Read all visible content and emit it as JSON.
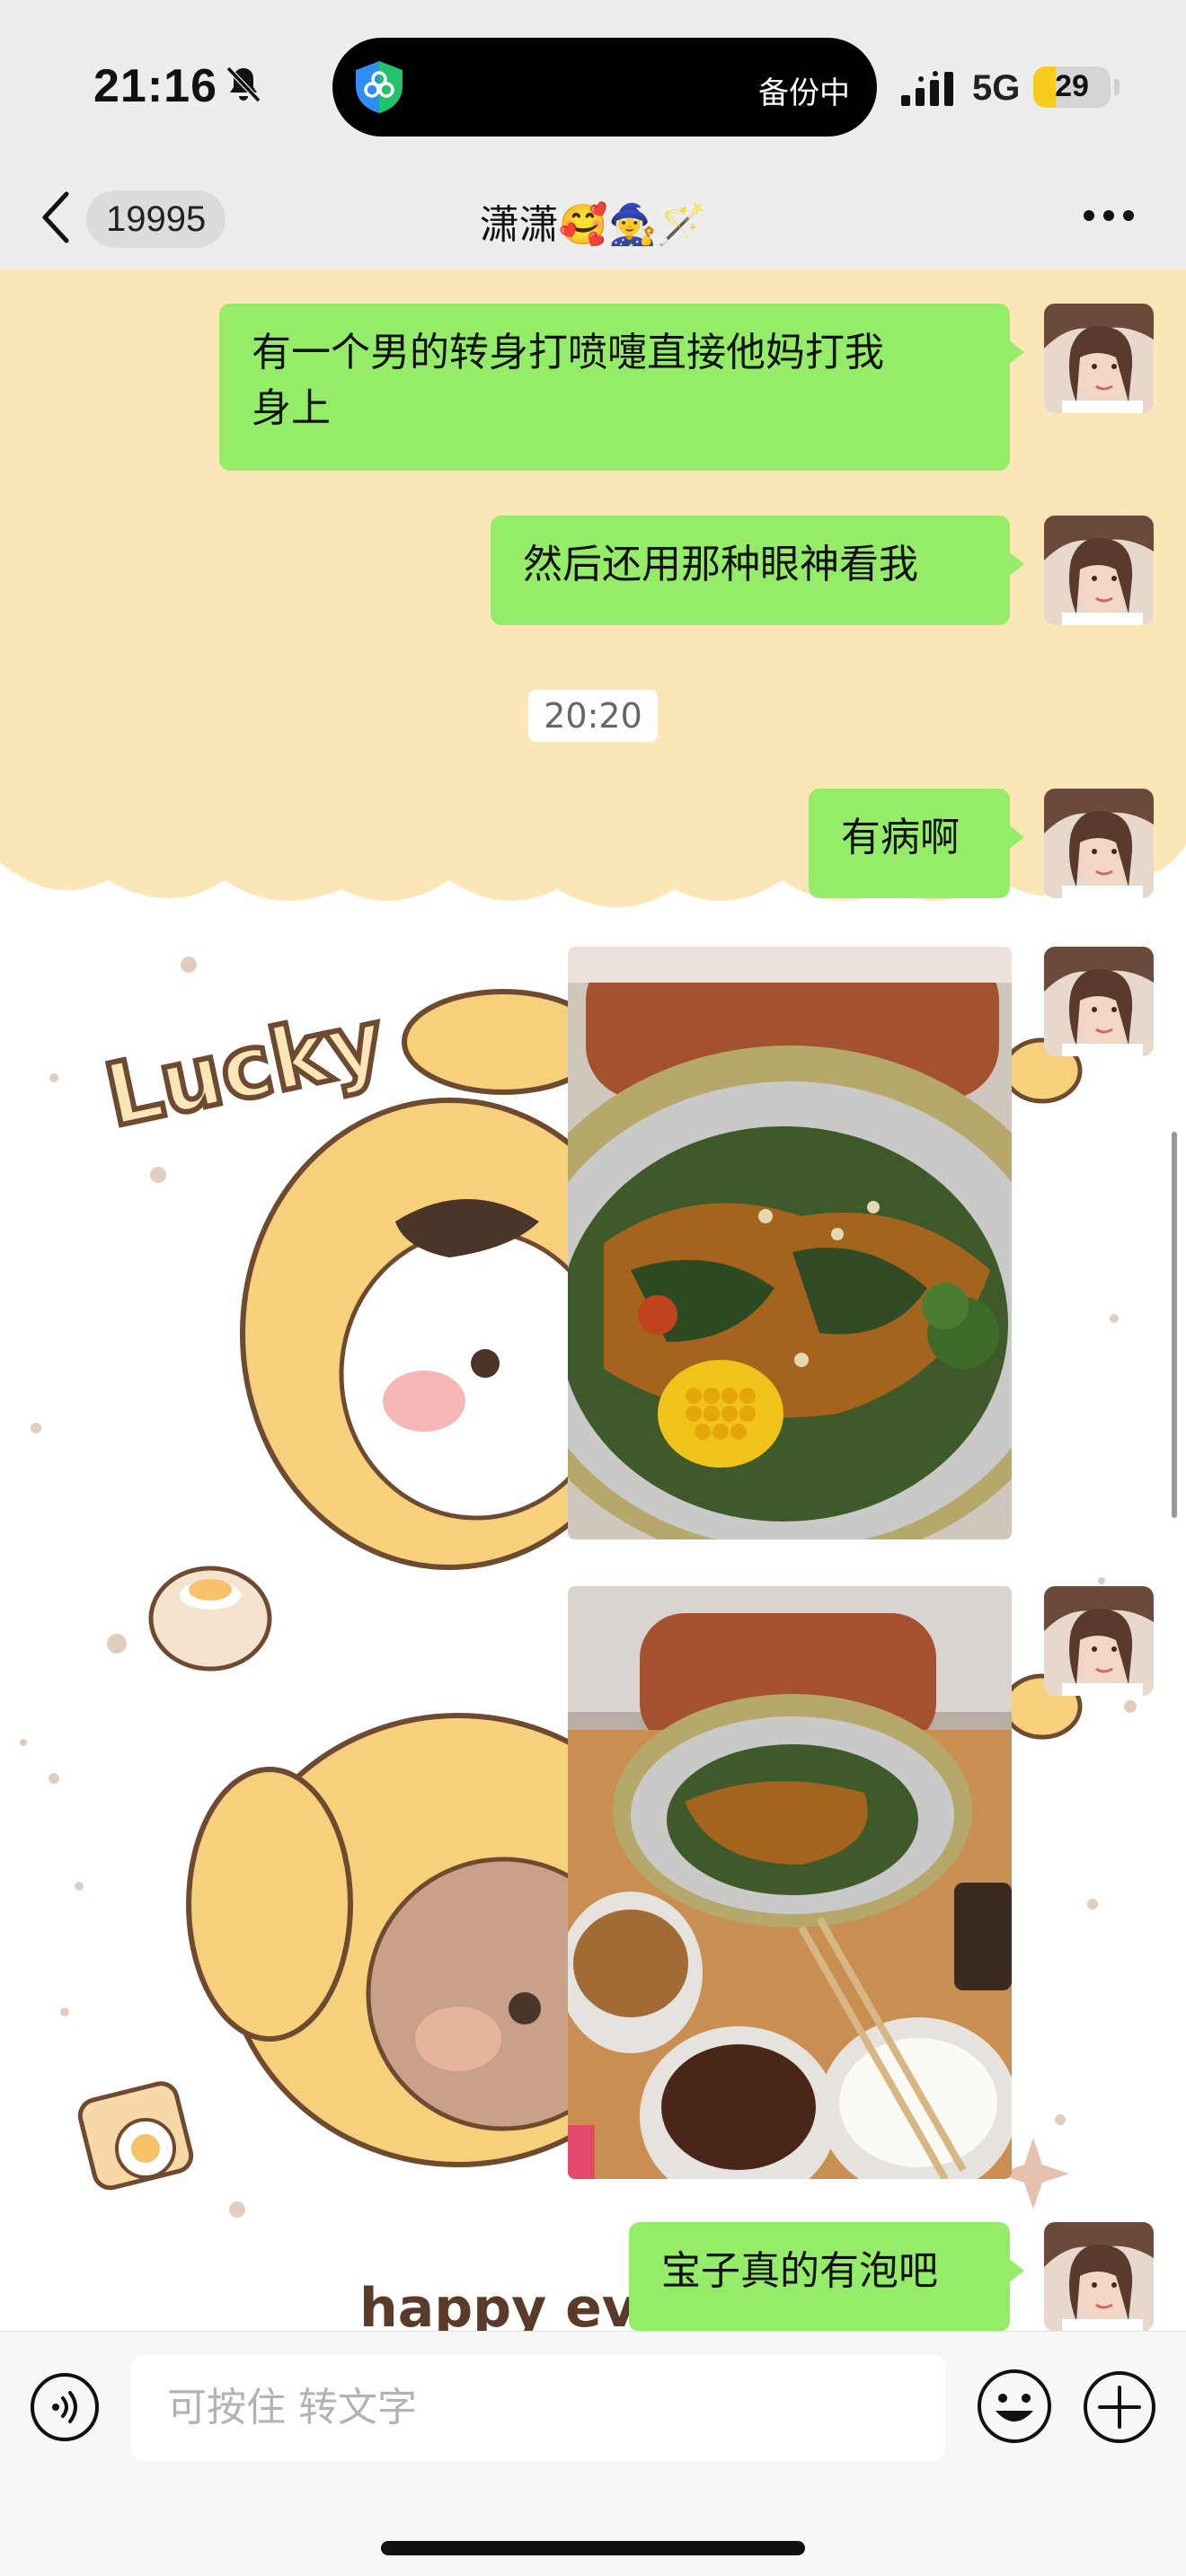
{
  "status_bar": {
    "time": "21:16",
    "island_text": "备份中",
    "network": "5G",
    "battery": "29",
    "battery_level": 0.29,
    "icons": [
      "bell-slash-icon",
      "shield-icon",
      "signal-icon"
    ]
  },
  "header": {
    "unread_count": "19995",
    "title": "潇潇🥰🧙‍♀️🪄",
    "icons": [
      "chevron-left-icon",
      "more-icon"
    ]
  },
  "chat": {
    "messages": [
      {
        "type": "text",
        "line1": "有一个男的转身打喷嚏直接他妈打我",
        "line2": "身上"
      },
      {
        "type": "text",
        "text": "然后还用那种眼神看我"
      },
      {
        "type": "time",
        "text": "20:20"
      },
      {
        "type": "text",
        "text": "有病啊"
      },
      {
        "type": "image",
        "alt": "food-photo"
      },
      {
        "type": "image",
        "alt": "food-photo"
      },
      {
        "type": "text",
        "text": "宝子真的有泡吧"
      }
    ],
    "wallpaper_text": [
      "Lucky",
      "happy eve"
    ]
  },
  "input_bar": {
    "placeholder": "可按住 转文字",
    "icons": [
      "voice-icon",
      "emoji-icon",
      "plus-icon"
    ]
  },
  "colors": {
    "bubble": "#95ec69",
    "wallpaper_cream": "#fbe6b8",
    "header_bg": "#ededed"
  }
}
